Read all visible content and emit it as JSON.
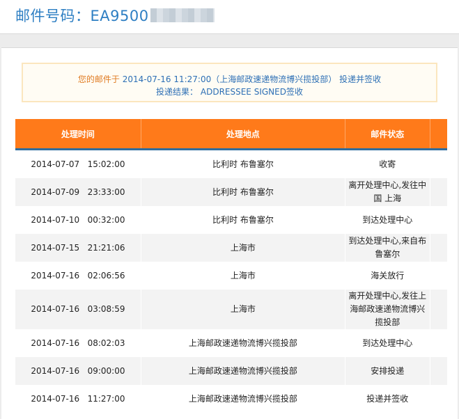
{
  "header": {
    "title": "邮件号码：EA9500"
  },
  "notice": {
    "prefix": "您的邮件于",
    "datetime": "2014-07-16 11:27:00",
    "location": "（上海邮政速递物流博兴揽投部）",
    "action": "投递并签收",
    "result_label": "投递结果：",
    "result_value": "ADDRESSEE SIGNED签收"
  },
  "table": {
    "headers": [
      "处理时间",
      "处理地点",
      "邮件状态"
    ],
    "rows": [
      {
        "time": "2014-07-07   15:02:00",
        "place": "比利时 布鲁塞尔",
        "status": "收寄"
      },
      {
        "time": "2014-07-09   23:33:00",
        "place": "比利时 布鲁塞尔",
        "status": "离开处理中心,发往中国 上海"
      },
      {
        "time": "2014-07-10   00:32:00",
        "place": "比利时 布鲁塞尔",
        "status": "到达处理中心"
      },
      {
        "time": "2014-07-15   21:21:06",
        "place": "上海市",
        "status": "到达处理中心,来自布鲁塞尔"
      },
      {
        "time": "2014-07-16   02:06:56",
        "place": "上海市",
        "status": "海关放行"
      },
      {
        "time": "2014-07-16   03:08:59",
        "place": "上海市",
        "status": "离开处理中心,发往上海邮政速递物流博兴揽投部"
      },
      {
        "time": "2014-07-16   08:02:03",
        "place": "上海邮政速递物流博兴揽投部",
        "status": "到达处理中心"
      },
      {
        "time": "2014-07-16   09:00:00",
        "place": "上海邮政速递物流博兴揽投部",
        "status": "安排投递"
      },
      {
        "time": "2014-07-16   11:27:00",
        "place": "上海邮政速递物流博兴揽投部",
        "status": "投递并签收"
      }
    ]
  }
}
